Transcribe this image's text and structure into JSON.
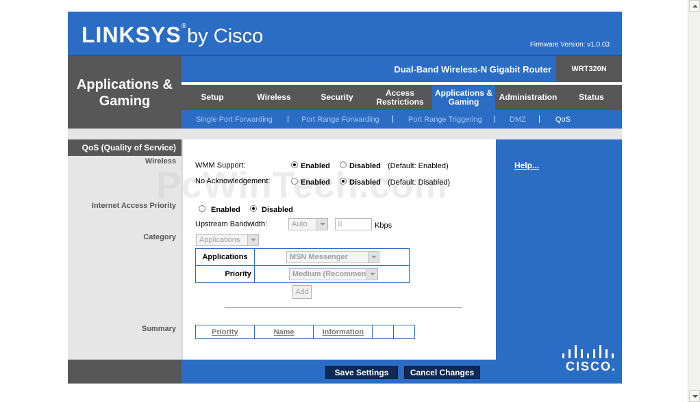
{
  "brand": {
    "logo_main": "LINKSYS",
    "logo_reg": "®",
    "logo_by": "by Cisco",
    "footer_logo": "CISCO."
  },
  "firmware": "Firmware Version: v1.0.03",
  "section_title": "Applications & Gaming",
  "product_name": "Dual-Band Wireless-N Gigabit Router",
  "model": "WRT320N",
  "tabs": [
    {
      "label": "Setup"
    },
    {
      "label": "Wireless"
    },
    {
      "label": "Security"
    },
    {
      "label": "Access Restrictions"
    },
    {
      "label": "Applications & Gaming",
      "active": true
    },
    {
      "label": "Administration"
    },
    {
      "label": "Status"
    }
  ],
  "subtabs": [
    {
      "label": "Single Port Forwarding"
    },
    {
      "label": "Port Range Forwarding"
    },
    {
      "label": "Port Range Triggering"
    },
    {
      "label": "DMZ"
    },
    {
      "label": "QoS",
      "active": true
    }
  ],
  "subtab_separator": "|",
  "left": {
    "header": "QoS (Quality of Service)",
    "wireless": "Wireless",
    "internet_access_priority": "Internet Access Priority",
    "category": "Category",
    "summary": "Summary"
  },
  "wireless": {
    "wmm_label": "WMM Support:",
    "wmm_enabled": "Enabled",
    "wmm_disabled": "Disabled",
    "wmm_default": "(Default: Enabled)",
    "wmm_selected": "Enabled",
    "noack_label": "No Acknowledgement:",
    "noack_enabled": "Enabled",
    "noack_disabled": "Disabled",
    "noack_default": "(Default: Disabled)",
    "noack_selected": "Disabled"
  },
  "internet_priority": {
    "enabled": "Enabled",
    "disabled": "Disabled",
    "selected": "Disabled",
    "upstream_label": "Upstream Bandwidth:",
    "upstream_mode": "Auto",
    "upstream_value": "0",
    "upstream_unit": "Kbps"
  },
  "category": {
    "select_value": "Applications",
    "applications_label": "Applications",
    "applications_value": "MSN Messenger",
    "priority_label": "Priority",
    "priority_value": "Medium (Recommend)",
    "add_button": "Add"
  },
  "summary_table": {
    "columns": [
      "Priority",
      "Name",
      "Information",
      "",
      ""
    ]
  },
  "help_link": "Help...",
  "footer": {
    "save": "Save Settings",
    "cancel": "Cancel Changes"
  },
  "watermark": "PcWinTech.com",
  "colors": {
    "blue": "#2b6cc4",
    "gray": "#575757",
    "light_gray": "#e6e6e6"
  }
}
